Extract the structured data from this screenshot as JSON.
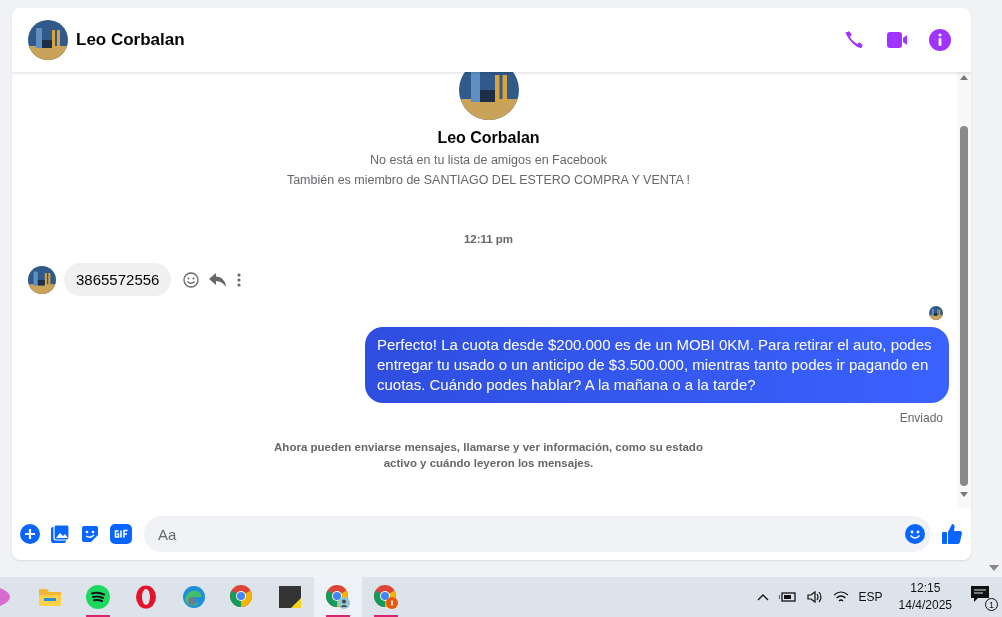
{
  "header": {
    "name": "Leo Corbalan"
  },
  "profile": {
    "name": "Leo Corbalan",
    "lines": [
      "No está en tu lista de amigos en Facebook",
      "También es miembro de SANTIAGO DEL ESTERO COMPRA Y VENTA !"
    ]
  },
  "timestamp": "12:11 pm",
  "messages": [
    {
      "kind": "incoming",
      "text": "3865572556"
    },
    {
      "kind": "outgoing",
      "text": "Perfecto! La cuota desde $200.000 es de un MOBI 0KM. Para retirar el auto, podes entregar tu usado o un anticipo de $3.500.000, mientras tanto podes ir pagando en cuotas. Cuándo podes hablar? A la mañana o a la tarde?",
      "status": "Enviado"
    }
  ],
  "notice": "Ahora pueden enviarse mensajes, llamarse y ver información, como su estado activo y cuándo leyeron los mensajes.",
  "composer": {
    "placeholder": "Aa"
  },
  "taskbar": {
    "apps": [
      {
        "kind": "partial",
        "running": false,
        "selected": false
      },
      {
        "kind": "folder",
        "running": false,
        "selected": false
      },
      {
        "kind": "music",
        "running": true,
        "selected": false
      },
      {
        "kind": "o-browser",
        "running": false,
        "selected": false
      },
      {
        "kind": "edge",
        "running": false,
        "selected": false
      },
      {
        "kind": "chrome",
        "running": false,
        "selected": false
      },
      {
        "kind": "notes",
        "running": false,
        "selected": false
      },
      {
        "kind": "chrome-user",
        "running": true,
        "selected": true
      },
      {
        "kind": "chrome-badge",
        "running": true,
        "selected": false
      }
    ],
    "tray": {
      "language": "ESP",
      "time": "12:15",
      "date": "14/4/2025",
      "notifications": "1"
    }
  }
}
